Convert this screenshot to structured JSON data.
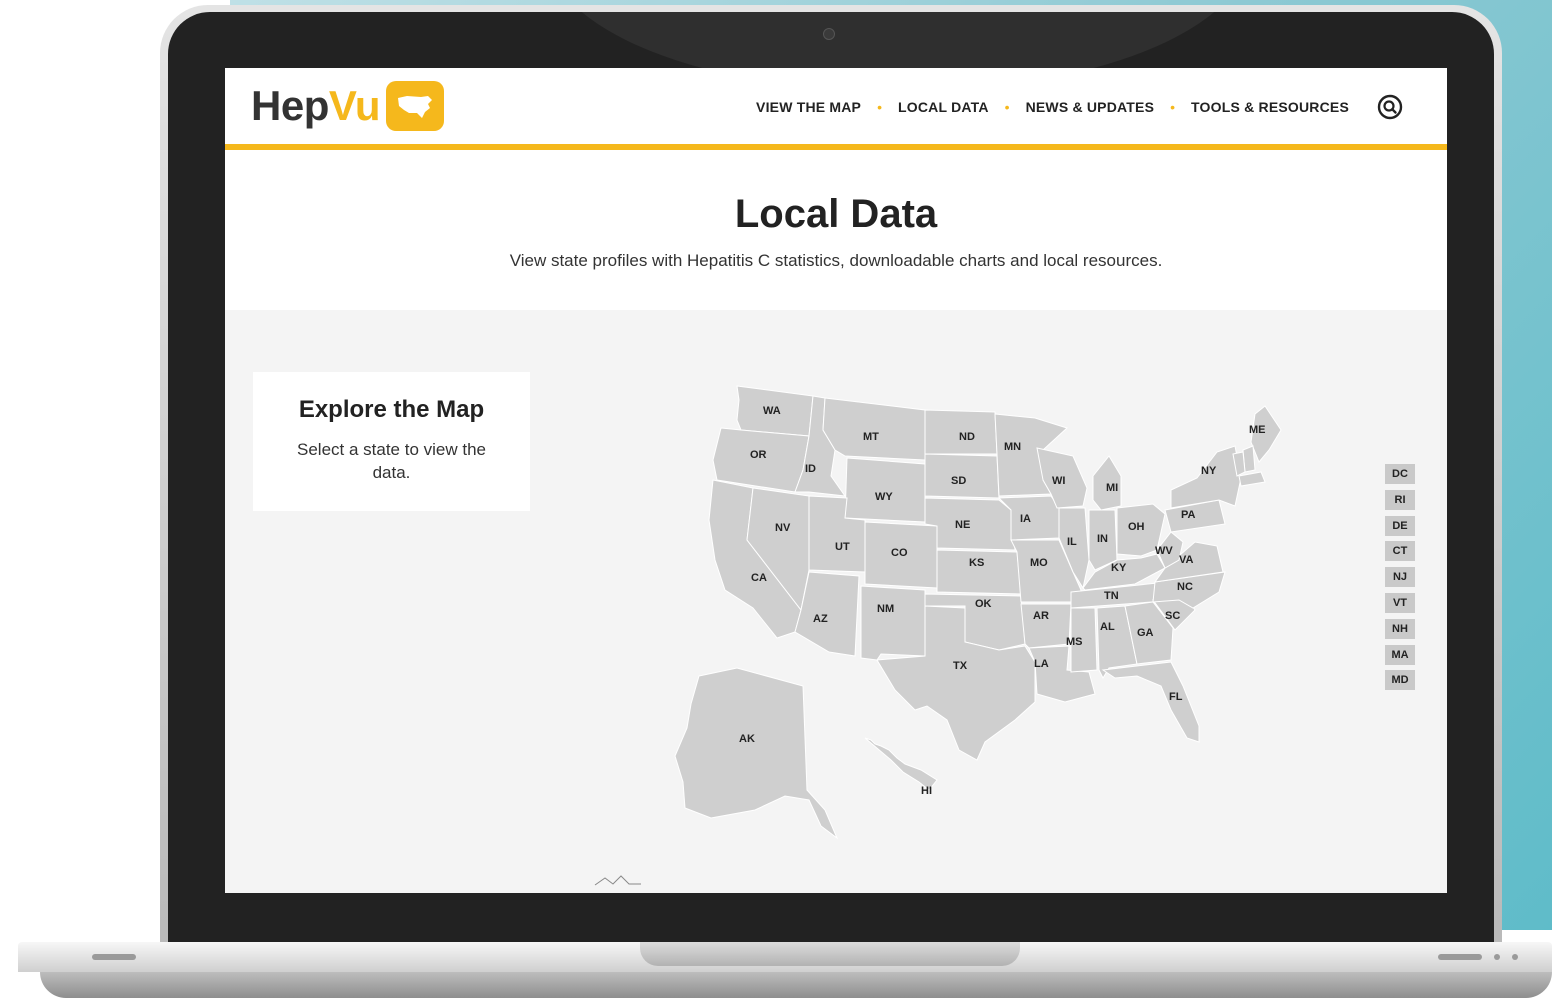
{
  "site": {
    "logo_text_a": "Hep",
    "logo_text_b": "Vu"
  },
  "nav": {
    "items": [
      {
        "label": "VIEW THE MAP"
      },
      {
        "label": "LOCAL DATA"
      },
      {
        "label": "NEWS & UPDATES"
      },
      {
        "label": "TOOLS & RESOURCES"
      }
    ],
    "separator": "•",
    "search_icon": "search-icon"
  },
  "hero": {
    "title": "Local Data",
    "subtitle": "View state profiles with Hepatitis C statistics, downloadable charts and local resources."
  },
  "explore": {
    "title": "Explore the Map",
    "text": "Select a state to view the data."
  },
  "map": {
    "states": [
      "WA",
      "OR",
      "CA",
      "ID",
      "NV",
      "MT",
      "WY",
      "UT",
      "AZ",
      "CO",
      "NM",
      "ND",
      "SD",
      "NE",
      "KS",
      "OK",
      "TX",
      "MN",
      "IA",
      "MO",
      "AR",
      "LA",
      "WI",
      "IL",
      "MI",
      "IN",
      "OH",
      "KY",
      "TN",
      "MS",
      "AL",
      "GA",
      "FL",
      "SC",
      "NC",
      "VA",
      "WV",
      "PA",
      "NY",
      "ME",
      "AK",
      "HI"
    ],
    "small_states": [
      "DC",
      "RI",
      "DE",
      "CT",
      "NJ",
      "VT",
      "NH",
      "MA",
      "MD"
    ]
  },
  "colors": {
    "accent": "#f5b81c",
    "state_fill": "#cfcfcf",
    "state_stroke": "#ffffff",
    "map_bg": "#f4f4f4"
  }
}
